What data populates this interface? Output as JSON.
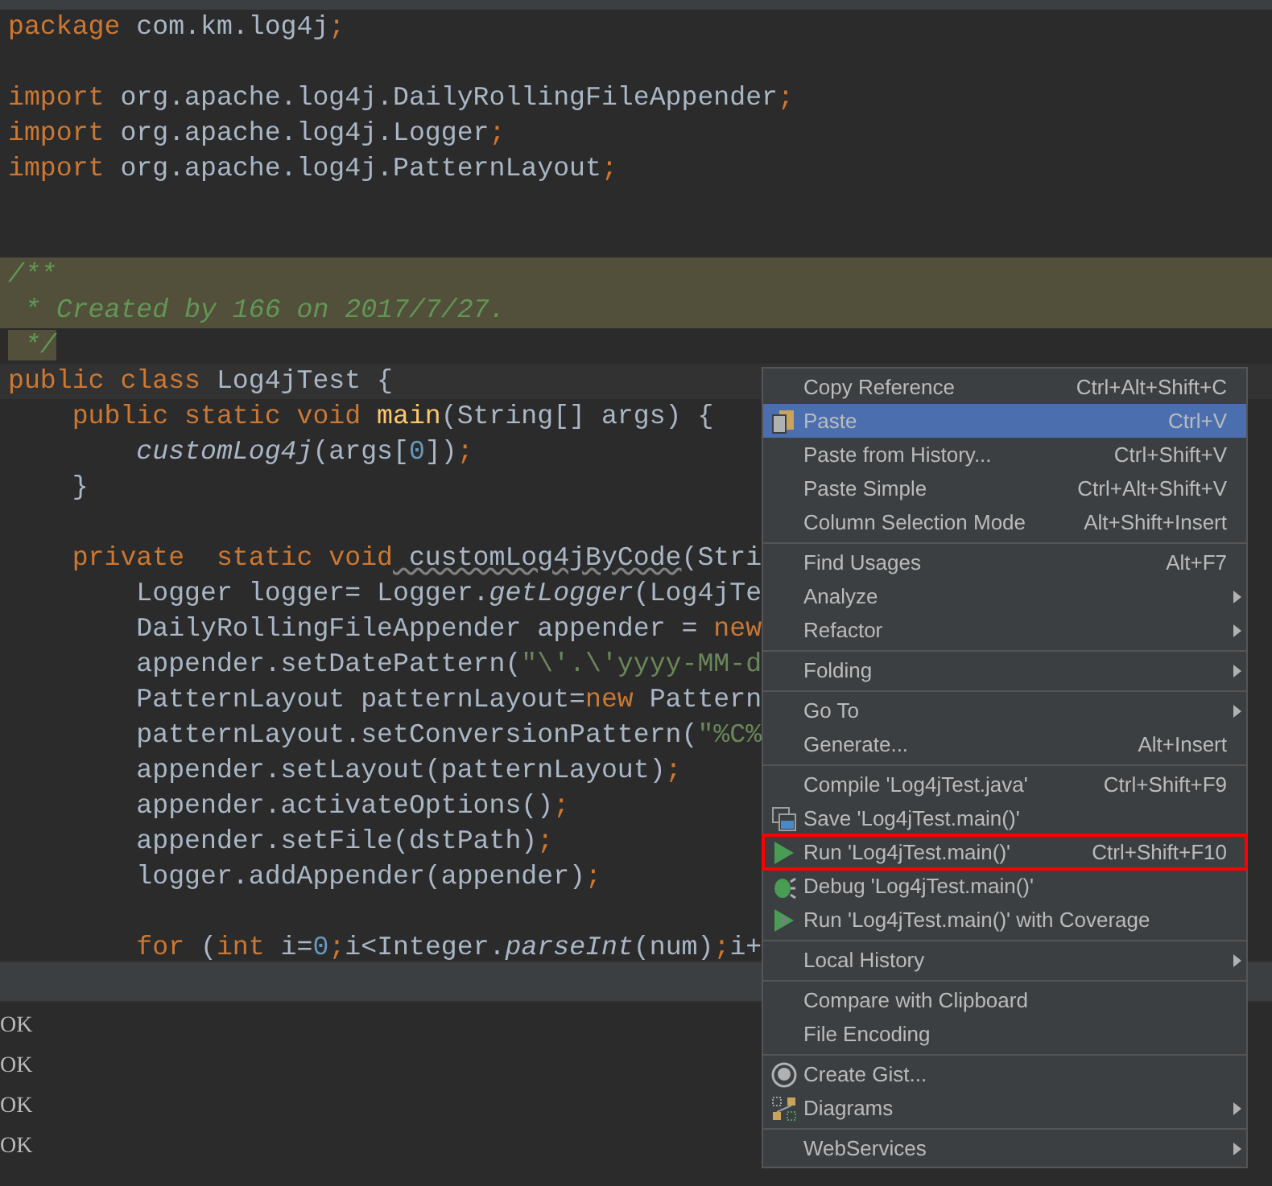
{
  "editor": {
    "lines": [
      {
        "tokens": [
          {
            "kind": "kw",
            "text": "package"
          },
          {
            "kind": "plain",
            "text": " com.km.log4j"
          },
          {
            "kind": "kw",
            "text": ";"
          }
        ]
      },
      {
        "kind": "blank"
      },
      {
        "tokens": [
          {
            "kind": "kw",
            "text": "import"
          },
          {
            "kind": "plain",
            "text": " org.apache.log4j.DailyRollingFileAppender"
          },
          {
            "kind": "kw",
            "text": ";"
          }
        ]
      },
      {
        "tokens": [
          {
            "kind": "kw",
            "text": "import"
          },
          {
            "kind": "plain",
            "text": " org.apache.log4j.Logger"
          },
          {
            "kind": "kw",
            "text": ";"
          }
        ]
      },
      {
        "tokens": [
          {
            "kind": "kw",
            "text": "import"
          },
          {
            "kind": "plain",
            "text": " org.apache.log4j.PatternLayout"
          },
          {
            "kind": "kw",
            "text": ";"
          }
        ]
      },
      {
        "kind": "blank"
      },
      {
        "kind": "blank"
      },
      {
        "kind": "band",
        "tokens": [
          {
            "kind": "comment",
            "text": "/**"
          }
        ]
      },
      {
        "kind": "band",
        "tokens": [
          {
            "kind": "comment",
            "text": " * Created by 166 on 2017/7/27."
          }
        ]
      },
      {
        "kind": "bandend",
        "tokens": [
          {
            "kind": "comment",
            "text": " */"
          }
        ]
      },
      {
        "kind": "current",
        "tokens": [
          {
            "kind": "kw",
            "text": "public class"
          },
          {
            "kind": "plain",
            "text": " Log4jTest {"
          }
        ]
      },
      {
        "tokens": [
          {
            "kind": "kw",
            "text": "    public static void"
          },
          {
            "kind": "decl",
            "text": " main"
          },
          {
            "kind": "plain",
            "text": "(String[] args) {"
          }
        ]
      },
      {
        "tokens": [
          {
            "kind": "static",
            "text": "        customLog4j"
          },
          {
            "kind": "plain",
            "text": "(args["
          },
          {
            "kind": "num",
            "text": "0"
          },
          {
            "kind": "plain",
            "text": "])"
          },
          {
            "kind": "kw",
            "text": ";"
          }
        ]
      },
      {
        "tokens": [
          {
            "kind": "plain",
            "text": "    }"
          }
        ]
      },
      {
        "kind": "blank"
      },
      {
        "tokens": [
          {
            "kind": "kw",
            "text": "    private  static void"
          },
          {
            "kind": "unused",
            "text": " customLog4jByCode"
          },
          {
            "kind": "plain",
            "text": "(Stri"
          }
        ]
      },
      {
        "tokens": [
          {
            "kind": "plain",
            "text": "        Logger logger= Logger."
          },
          {
            "kind": "static",
            "text": "getLogger"
          },
          {
            "kind": "plain",
            "text": "(Log4jTe"
          }
        ]
      },
      {
        "tokens": [
          {
            "kind": "plain",
            "text": "        DailyRollingFileAppender appender = "
          },
          {
            "kind": "kw",
            "text": "new"
          }
        ]
      },
      {
        "tokens": [
          {
            "kind": "plain",
            "text": "        appender.setDatePattern("
          },
          {
            "kind": "string",
            "text": "\"\\'.\\'yyyy-MM-d"
          }
        ]
      },
      {
        "tokens": [
          {
            "kind": "plain",
            "text": "        PatternLayout patternLayout="
          },
          {
            "kind": "kw",
            "text": "new"
          },
          {
            "kind": "plain",
            "text": " Pattern"
          }
        ]
      },
      {
        "tokens": [
          {
            "kind": "plain",
            "text": "        patternLayout.setConversionPattern("
          },
          {
            "kind": "string",
            "text": "\"%C%"
          }
        ]
      },
      {
        "tokens": [
          {
            "kind": "plain",
            "text": "        appender.setLayout(patternLayout)"
          },
          {
            "kind": "kw",
            "text": ";"
          }
        ]
      },
      {
        "tokens": [
          {
            "kind": "plain",
            "text": "        appender.activateOptions()"
          },
          {
            "kind": "kw",
            "text": ";"
          }
        ]
      },
      {
        "tokens": [
          {
            "kind": "plain",
            "text": "        appender.setFile(dstPath)"
          },
          {
            "kind": "kw",
            "text": ";"
          }
        ]
      },
      {
        "tokens": [
          {
            "kind": "plain",
            "text": "        logger.addAppender(appender)"
          },
          {
            "kind": "kw",
            "text": ";"
          }
        ]
      },
      {
        "kind": "blank"
      },
      {
        "tokens": [
          {
            "kind": "kw",
            "text": "        for"
          },
          {
            "kind": "plain",
            "text": " ("
          },
          {
            "kind": "kw",
            "text": "int"
          },
          {
            "kind": "plain",
            "text": " i="
          },
          {
            "kind": "num",
            "text": "0"
          },
          {
            "kind": "kw",
            "text": ";"
          },
          {
            "kind": "plain",
            "text": "i<Integer."
          },
          {
            "kind": "static",
            "text": "parseInt"
          },
          {
            "kind": "plain",
            "text": "(num)"
          },
          {
            "kind": "kw",
            "text": ";"
          },
          {
            "kind": "plain",
            "text": "i+"
          }
        ]
      }
    ]
  },
  "console": {
    "lines": [
      "OK",
      "OK",
      "OK",
      "OK"
    ]
  },
  "context_menu": {
    "sections": [
      [
        {
          "kind": "plain",
          "label": "Copy Reference",
          "shortcut": "Ctrl+Alt+Shift+C",
          "submenu": false,
          "selected": false,
          "outlined": false
        },
        {
          "kind": "paste",
          "label": "Paste",
          "shortcut": "Ctrl+V",
          "submenu": false,
          "selected": true,
          "outlined": false
        },
        {
          "kind": "plain",
          "label": "Paste from History...",
          "shortcut": "Ctrl+Shift+V",
          "submenu": false,
          "selected": false,
          "outlined": false
        },
        {
          "kind": "plain",
          "label": "Paste Simple",
          "shortcut": "Ctrl+Alt+Shift+V",
          "submenu": false,
          "selected": false,
          "outlined": false
        },
        {
          "kind": "plain",
          "label": "Column Selection Mode",
          "shortcut": "Alt+Shift+Insert",
          "submenu": false,
          "selected": false,
          "outlined": false
        }
      ],
      [
        {
          "kind": "plain",
          "label": "Find Usages",
          "shortcut": "Alt+F7",
          "submenu": false,
          "selected": false,
          "outlined": false
        },
        {
          "kind": "plain",
          "label": "Analyze",
          "submenu": true,
          "selected": false,
          "outlined": false
        },
        {
          "kind": "plain",
          "label": "Refactor",
          "submenu": true,
          "selected": false,
          "outlined": false
        }
      ],
      [
        {
          "kind": "plain",
          "label": "Folding",
          "submenu": true,
          "selected": false,
          "outlined": false
        }
      ],
      [
        {
          "kind": "plain",
          "label": "Go To",
          "submenu": true,
          "selected": false,
          "outlined": false
        },
        {
          "kind": "plain",
          "label": "Generate...",
          "shortcut": "Alt+Insert",
          "submenu": false,
          "selected": false,
          "outlined": false
        }
      ],
      [
        {
          "kind": "plain",
          "label": "Compile 'Log4jTest.java'",
          "shortcut": "Ctrl+Shift+F9",
          "submenu": false,
          "selected": false,
          "outlined": false
        },
        {
          "kind": "save",
          "label": "Save 'Log4jTest.main()'",
          "submenu": false,
          "selected": false,
          "outlined": false
        },
        {
          "kind": "run",
          "label": "Run 'Log4jTest.main()'",
          "shortcut": "Ctrl+Shift+F10",
          "submenu": false,
          "selected": false,
          "outlined": true
        },
        {
          "kind": "debug",
          "label": "Debug 'Log4jTest.main()'",
          "submenu": false,
          "selected": false,
          "outlined": false
        },
        {
          "kind": "coverage",
          "label": "Run 'Log4jTest.main()' with Coverage",
          "submenu": false,
          "selected": false,
          "outlined": false
        }
      ],
      [
        {
          "kind": "plain",
          "label": "Local History",
          "submenu": true,
          "selected": false,
          "outlined": false
        }
      ],
      [
        {
          "kind": "plain",
          "label": "Compare with Clipboard",
          "submenu": false,
          "selected": false,
          "outlined": false
        },
        {
          "kind": "plain",
          "label": "File Encoding",
          "submenu": false,
          "selected": false,
          "outlined": false
        }
      ],
      [
        {
          "kind": "gist",
          "label": "Create Gist...",
          "submenu": false,
          "selected": false,
          "outlined": false
        },
        {
          "kind": "diagrams",
          "label": "Diagrams",
          "submenu": true,
          "selected": false,
          "outlined": false
        }
      ],
      [
        {
          "kind": "plain",
          "label": "WebServices",
          "submenu": true,
          "selected": false,
          "outlined": false
        }
      ]
    ]
  }
}
